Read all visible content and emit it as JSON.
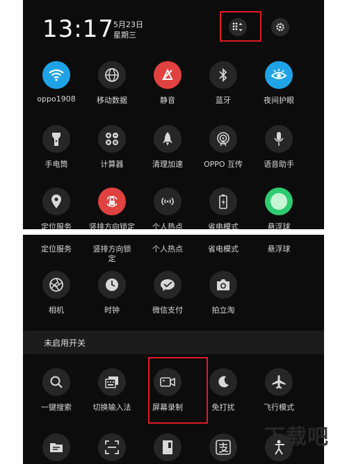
{
  "status": {
    "time": "13:17",
    "date": "5月23日",
    "weekday": "星期三"
  },
  "colors": {
    "wifi": "#1fa3e6",
    "mute": "#e0423f",
    "night": "#1fa3e6",
    "lock": "#e0423f",
    "float": "#2ecc71"
  },
  "top_row1": [
    {
      "label": "oppo1908",
      "icon": "wifi-icon"
    },
    {
      "label": "移动数据",
      "icon": "globe-icon"
    },
    {
      "label": "静音",
      "icon": "mute-icon"
    },
    {
      "label": "蓝牙",
      "icon": "bluetooth-icon"
    },
    {
      "label": "夜间护眼",
      "icon": "eye-icon"
    }
  ],
  "top_row2": [
    {
      "label": "手电筒",
      "icon": "flashlight-icon"
    },
    {
      "label": "计算器",
      "icon": "calculator-icon"
    },
    {
      "label": "清理加速",
      "icon": "rocket-icon"
    },
    {
      "label": "OPPO 互传",
      "icon": "share-icon"
    },
    {
      "label": "语音助手",
      "icon": "microphone-icon"
    }
  ],
  "top_row3_cut": [
    "定位服务",
    "竖排方向锁定",
    "个人热点",
    "省电模式",
    "悬浮球"
  ],
  "bottom_labels_top": [
    "定位服务",
    "竖排方向锁",
    "个人热点",
    "省电模式",
    "悬浮球"
  ],
  "bottom_labels_top_wrap": "定",
  "bottom_row1": [
    {
      "label": "相机",
      "icon": "camera-aperture-icon"
    },
    {
      "label": "时钟",
      "icon": "clock-icon"
    },
    {
      "label": "微信支付",
      "icon": "wechat-pay-icon"
    },
    {
      "label": "拍立淘",
      "icon": "photo-camera-icon"
    }
  ],
  "section_title": "未启用开关",
  "bottom_row2": [
    {
      "label": "一键搜索",
      "icon": "search-icon"
    },
    {
      "label": "切换输入法",
      "icon": "keyboard-icon"
    },
    {
      "label": "屏幕录制",
      "icon": "screen-record-icon"
    },
    {
      "label": "免打扰",
      "icon": "moon-icon"
    },
    {
      "label": "飞行模式",
      "icon": "airplane-icon"
    }
  ],
  "watermark": "下载吧"
}
